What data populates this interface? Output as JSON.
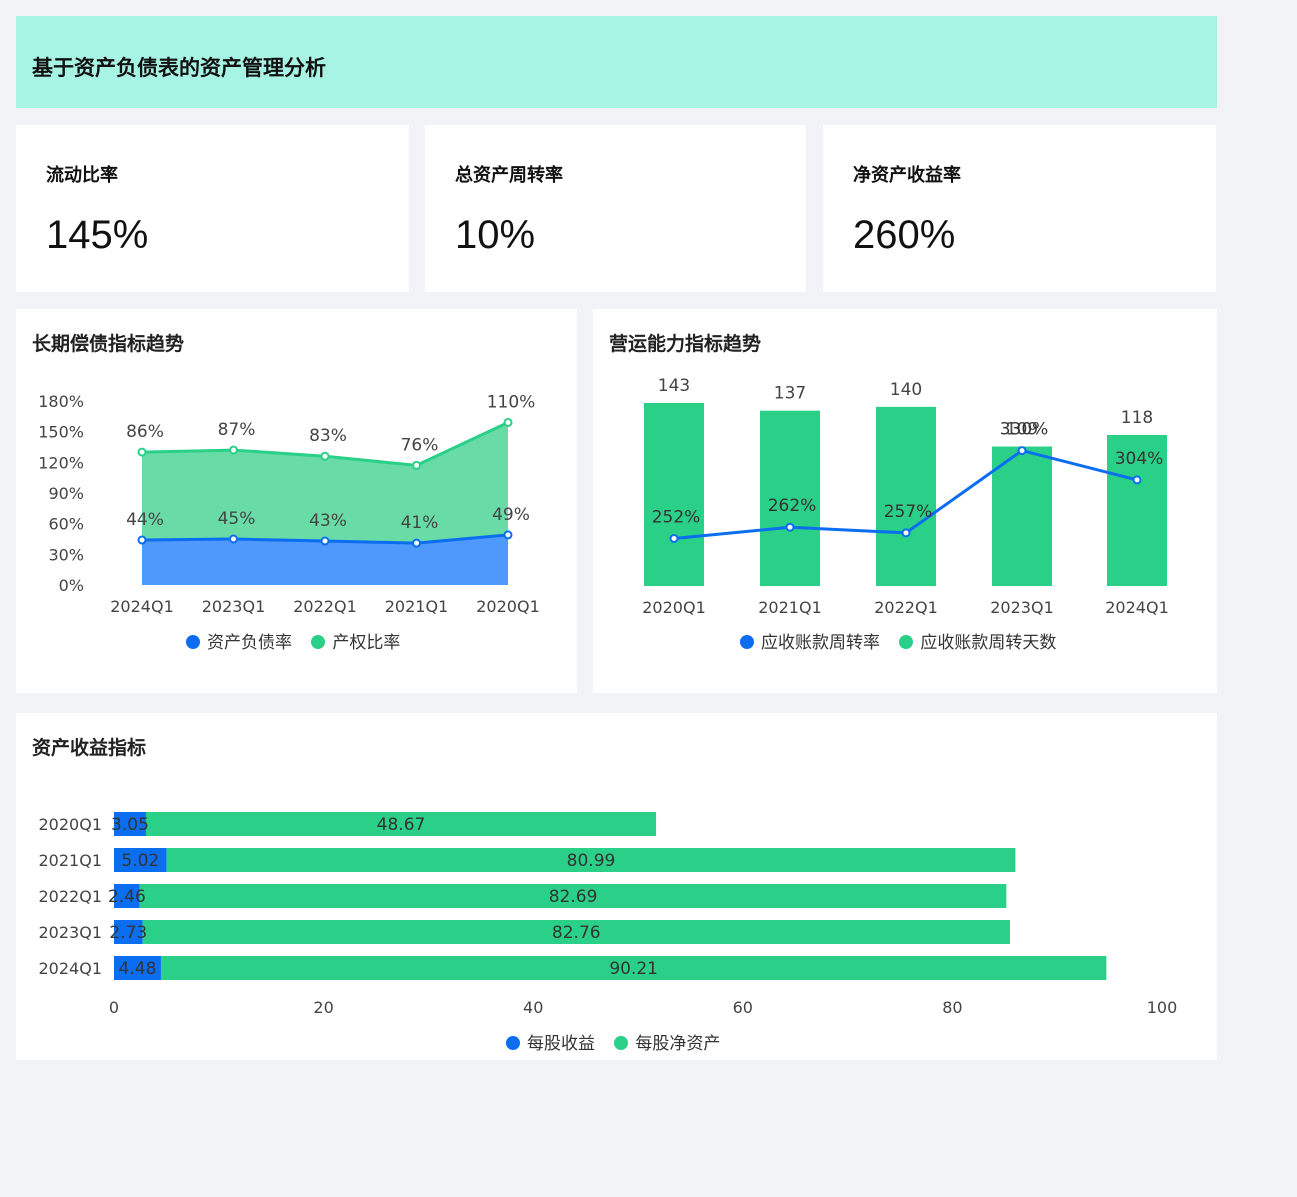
{
  "header": {
    "title": "基于资产负债表的资产管理分析",
    "bg_color": "#a8f4e4"
  },
  "kpis": [
    {
      "title": "流动比率",
      "value": "145%"
    },
    {
      "title": "总资产周转率",
      "value": "10%"
    },
    {
      "title": "净资产收益率",
      "value": "260%"
    }
  ],
  "colors": {
    "blue": "#0b6ef0",
    "green": "#2ad087"
  },
  "chart_data": [
    {
      "type": "area",
      "title": "长期偿债指标趋势",
      "categories": [
        "2024Q1",
        "2023Q1",
        "2022Q1",
        "2021Q1",
        "2020Q1"
      ],
      "ylim": [
        0,
        180
      ],
      "y_ticks": [
        "0%",
        "30%",
        "60%",
        "90%",
        "120%",
        "150%",
        "180%"
      ],
      "stacked": true,
      "series": [
        {
          "name": "资产负债率",
          "values": [
            44,
            45,
            43,
            41,
            49
          ],
          "labels": [
            "44%",
            "45%",
            "43%",
            "41%",
            "49%"
          ],
          "color": "#0b6ef0"
        },
        {
          "name": "产权比率",
          "values": [
            86,
            87,
            83,
            76,
            110
          ],
          "labels": [
            "86%",
            "87%",
            "83%",
            "76%",
            "110%"
          ],
          "color": "#2ad087"
        }
      ],
      "legend": "bottom",
      "grid": false
    },
    {
      "type": "bar+line",
      "title": "营运能力指标趋势",
      "categories": [
        "2020Q1",
        "2021Q1",
        "2022Q1",
        "2023Q1",
        "2024Q1"
      ],
      "bar_series": {
        "name": "应收账款周转天数",
        "values": [
          143,
          137,
          140,
          109,
          118
        ],
        "labels": [
          "143",
          "137",
          "140",
          "109",
          "118"
        ],
        "color": "#2ad087"
      },
      "line_series": {
        "name": "应收账款周转率",
        "values": [
          252,
          262,
          257,
          330,
          304
        ],
        "labels": [
          "252%",
          "262%",
          "257%",
          "330%",
          "304%"
        ],
        "color": "#0b6ef0"
      },
      "legend": "bottom",
      "grid": false
    },
    {
      "type": "bar",
      "orientation": "horizontal",
      "stacked": true,
      "title": "资产收益指标",
      "categories": [
        "2020Q1",
        "2021Q1",
        "2022Q1",
        "2023Q1",
        "2024Q1"
      ],
      "series": [
        {
          "name": "每股收益",
          "values": [
            3.05,
            5.02,
            2.46,
            2.73,
            4.48
          ],
          "labels": [
            "3.05",
            "5.02",
            "2.46",
            "2.73",
            "4.48"
          ],
          "color": "#0b6ef0"
        },
        {
          "name": "每股净资产",
          "values": [
            48.67,
            80.99,
            82.69,
            82.76,
            90.21
          ],
          "labels": [
            "48.67",
            "80.99",
            "82.69",
            "82.76",
            "90.21"
          ],
          "color": "#2ad087"
        }
      ],
      "xlim": [
        0,
        100
      ],
      "x_ticks": [
        "0",
        "20",
        "40",
        "60",
        "80",
        "100"
      ],
      "legend": "bottom",
      "grid": false
    }
  ]
}
